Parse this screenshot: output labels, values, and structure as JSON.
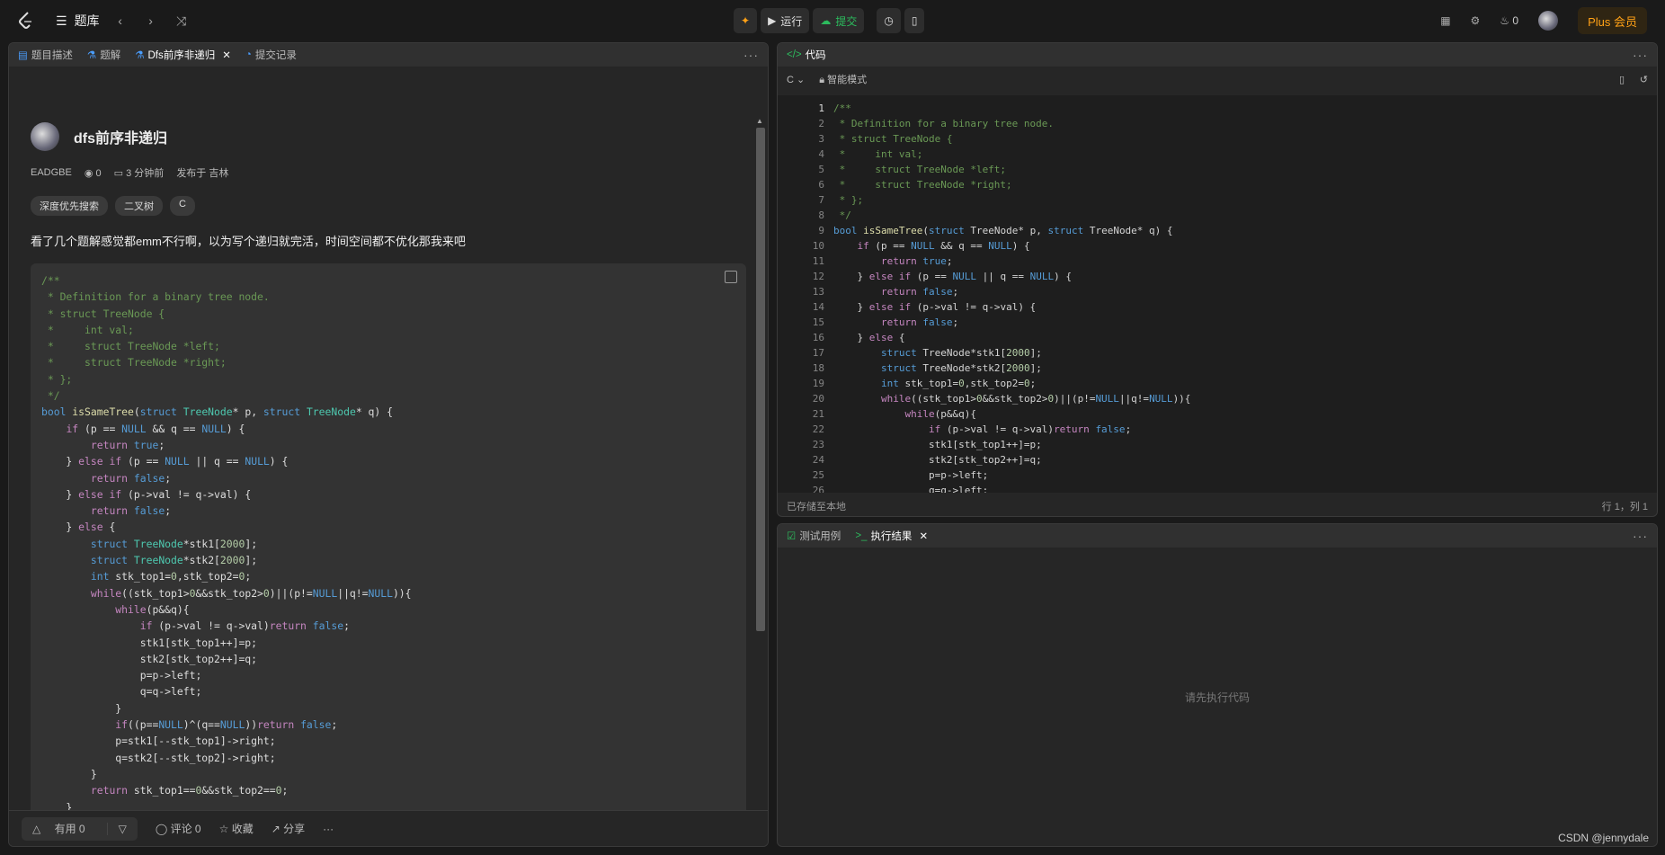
{
  "topbar": {
    "title": "题库",
    "run_label": "运行",
    "submit_label": "提交",
    "fire_count": "0",
    "plus_label": "Plus 会员"
  },
  "left_panel": {
    "tabs": [
      "题目描述",
      "题解",
      "Dfs前序非递归",
      "提交记录"
    ],
    "solution_title": "dfs前序非递归",
    "author": "EADGBE",
    "views": "0",
    "time": "3 分钟前",
    "location": "发布于 吉林",
    "tags": [
      "深度优先搜索",
      "二叉树",
      "C"
    ],
    "description": "看了几个题解感觉都emm不行啊，以为写个递归就完活，时间空间都不优化那我来吧",
    "useful_label": "有用 0",
    "comment_label": "评论 0",
    "favorite_label": "收藏",
    "share_label": "分享"
  },
  "code_panel": {
    "title": "代码",
    "language": "C",
    "mode": "智能模式",
    "saved": "已存储至本地",
    "cursor": "行 1，列 1",
    "line_count": 26
  },
  "result_panel": {
    "tabs": [
      "测试用例",
      "执行结果"
    ],
    "empty_text": "请先执行代码"
  },
  "watermark": "CSDN @jennydale",
  "colors": {
    "accent": "#ffa116",
    "submit": "#2cbb5d",
    "bg": "#1a1a1a"
  }
}
